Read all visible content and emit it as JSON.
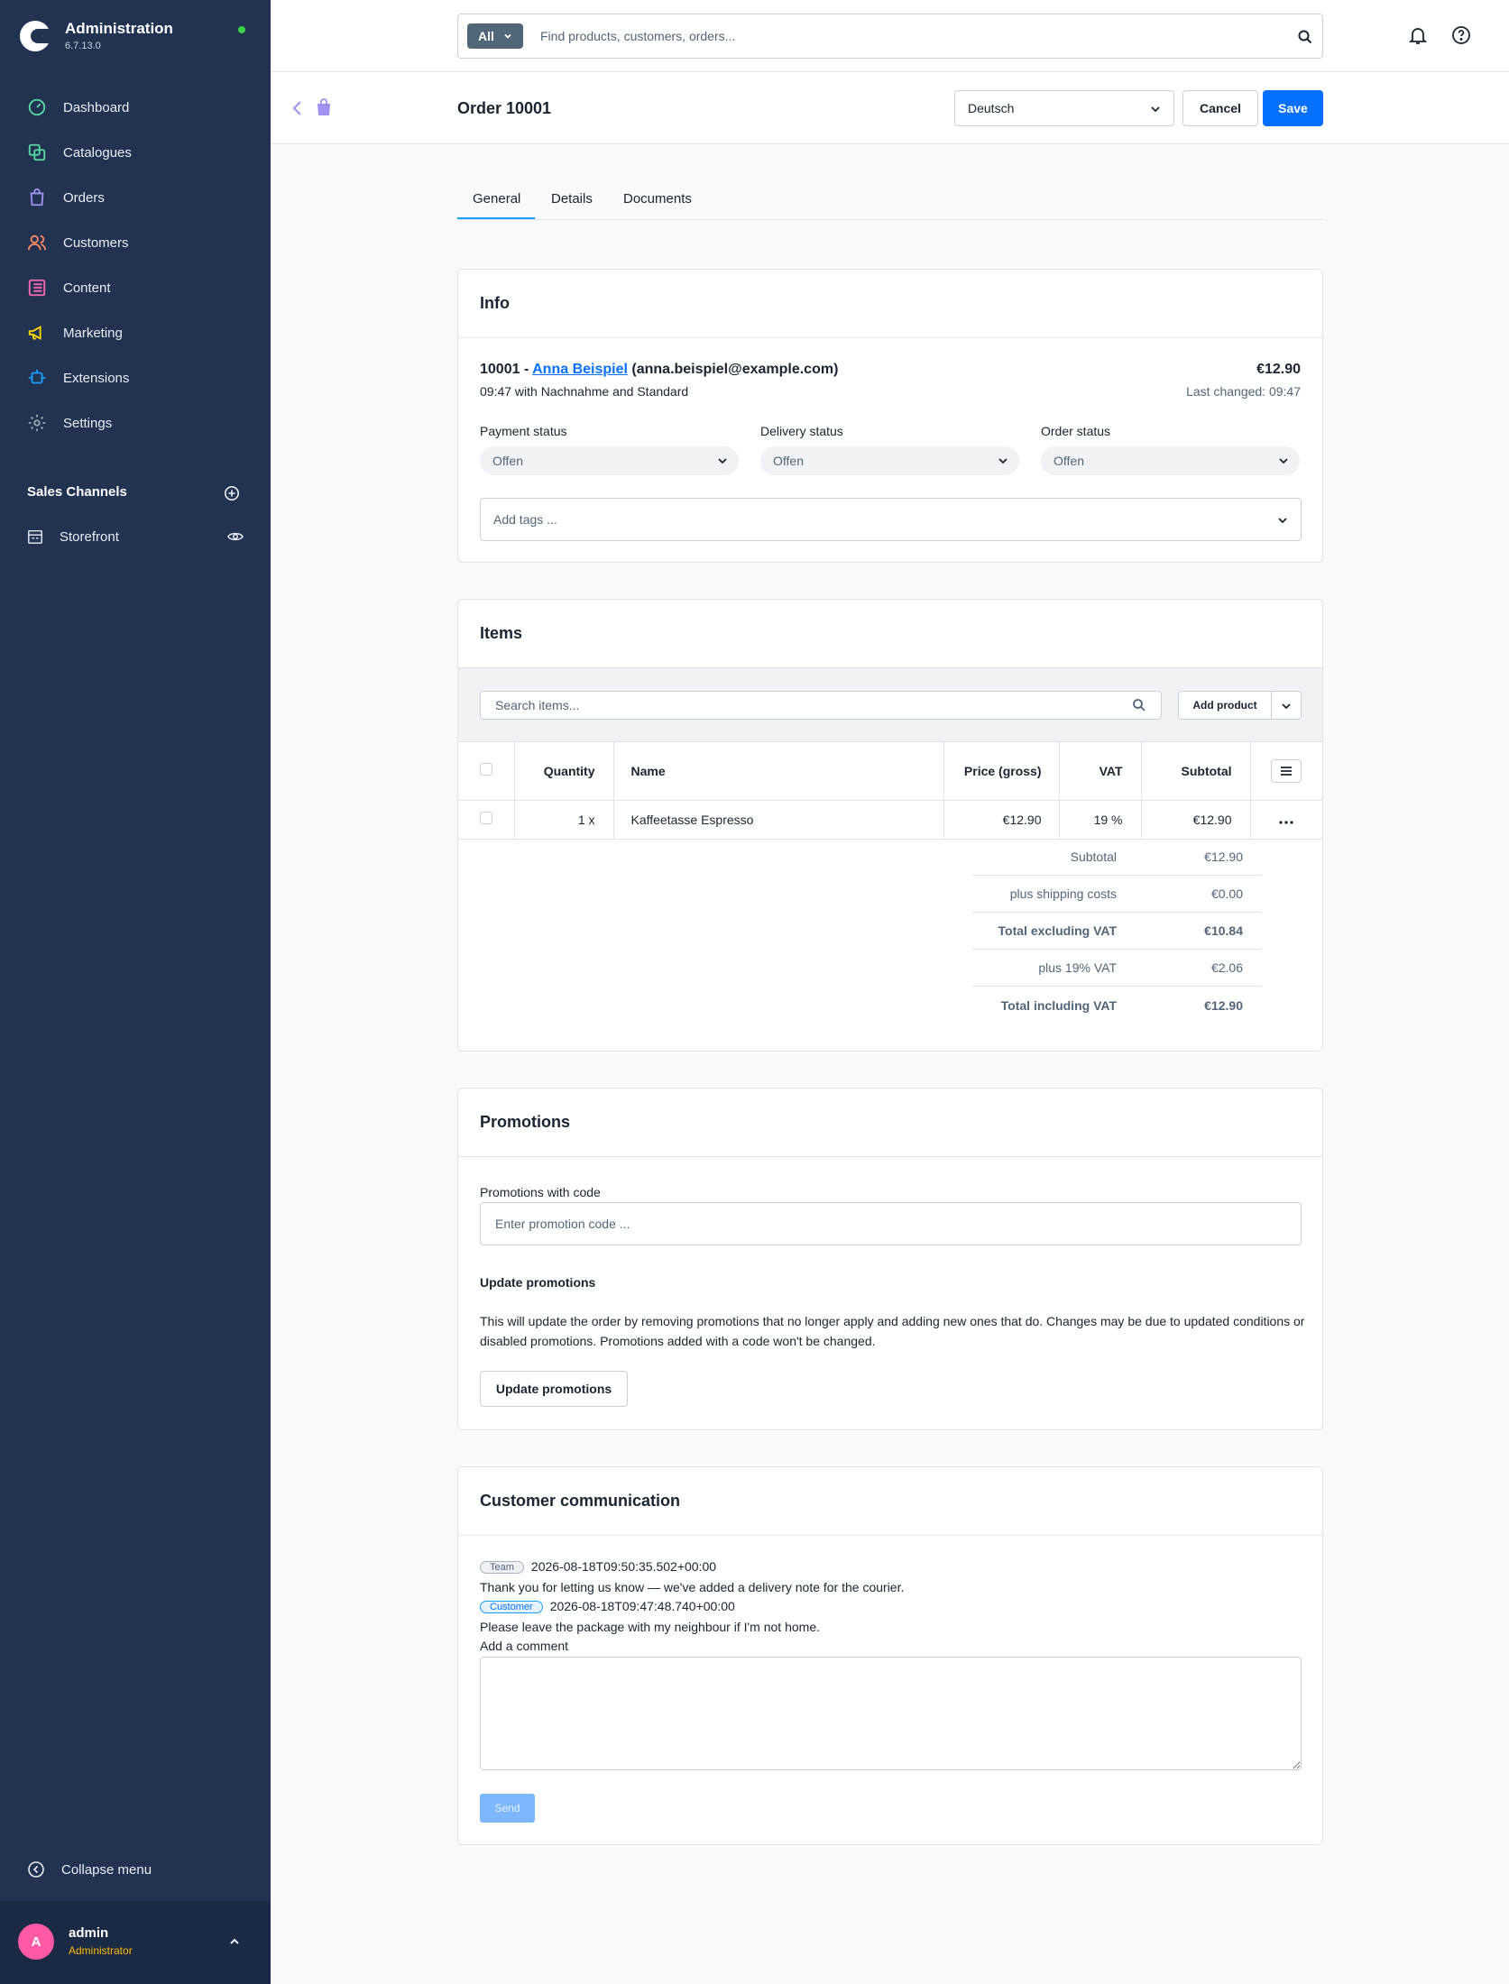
{
  "app": {
    "title": "Administration",
    "version": "6.7.13.0"
  },
  "sidebar": {
    "items": [
      {
        "label": "Dashboard",
        "icon": "dashboard-icon",
        "color": "#57d9a3"
      },
      {
        "label": "Catalogues",
        "icon": "catalogue-icon",
        "color": "#57d9a3"
      },
      {
        "label": "Orders",
        "icon": "orders-icon",
        "color": "#a092f0"
      },
      {
        "label": "Customers",
        "icon": "customers-icon",
        "color": "#f88962"
      },
      {
        "label": "Content",
        "icon": "content-icon",
        "color": "#ff68b4"
      },
      {
        "label": "Marketing",
        "icon": "marketing-icon",
        "color": "#ffd700"
      },
      {
        "label": "Extensions",
        "icon": "extensions-icon",
        "color": "#189eff"
      },
      {
        "label": "Settings",
        "icon": "settings-icon",
        "color": "#9aa8b5"
      }
    ],
    "sales_channels_title": "Sales Channels",
    "storefront": "Storefront",
    "collapse_label": "Collapse menu",
    "user": {
      "initial": "A",
      "name": "admin",
      "role": "Administrator"
    }
  },
  "topbar": {
    "search_type": "All",
    "search_placeholder": "Find products, customers, orders..."
  },
  "smartbar": {
    "title": "Order 10001",
    "language": "Deutsch",
    "cancel": "Cancel",
    "save": "Save"
  },
  "tabs": [
    "General",
    "Details",
    "Documents"
  ],
  "info": {
    "title": "Info",
    "order_number": "10001 -",
    "customer_name": "Anna Beispiel",
    "customer_email": "(anna.beispiel@example.com)",
    "subline": "09:47 with Nachnahme and Standard",
    "total": "€12.90",
    "last_changed": "Last changed: 09:47",
    "payment_status_label": "Payment status",
    "payment_status": "Offen",
    "delivery_status_label": "Delivery status",
    "delivery_status": "Offen",
    "order_status_label": "Order status",
    "order_status": "Offen",
    "tags_placeholder": "Add tags ..."
  },
  "items": {
    "title": "Items",
    "search_placeholder": "Search items...",
    "add_product": "Add product",
    "columns": {
      "quantity": "Quantity",
      "name": "Name",
      "price": "Price (gross)",
      "vat": "VAT",
      "subtotal": "Subtotal"
    },
    "rows": [
      {
        "quantity": "1 x",
        "name": "Kaffeetasse Espresso",
        "price": "€12.90",
        "vat": "19 %",
        "subtotal": "€12.90"
      }
    ],
    "totals": [
      {
        "label": "Subtotal",
        "value": "€12.90",
        "bold": false
      },
      {
        "label": "plus shipping costs",
        "value": "€0.00",
        "bold": false
      },
      {
        "label": "Total excluding VAT",
        "value": "€10.84",
        "bold": true
      },
      {
        "label": "plus 19% VAT",
        "value": "€2.06",
        "bold": false
      },
      {
        "label": "Total including VAT",
        "value": "€12.90",
        "bold": true
      }
    ]
  },
  "promotions": {
    "title": "Promotions",
    "code_label": "Promotions with code",
    "code_placeholder": "Enter promotion code ...",
    "update_heading": "Update promotions",
    "update_desc": "This will update the order by removing promotions that no longer apply and adding new ones that do. Changes may be due to updated conditions or disabled promotions. Promotions added with a code won't be changed.",
    "update_button": "Update promotions"
  },
  "communication": {
    "title": "Customer communication",
    "messages": [
      {
        "role": "Team",
        "timestamp": "2026-08-18T09:50:35.502+00:00",
        "text": "Thank you for letting us know — we've added a delivery note for the courier."
      },
      {
        "role": "Customer",
        "timestamp": "2026-08-18T09:47:48.740+00:00",
        "text": "Please leave the package with my neighbour if I'm not home."
      }
    ],
    "comment_label": "Add a comment",
    "send": "Send"
  }
}
